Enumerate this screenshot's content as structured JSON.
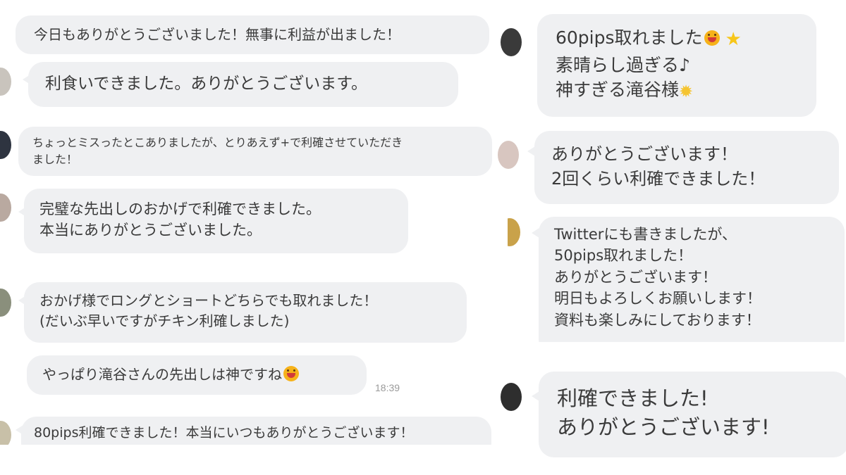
{
  "colors": {
    "bubble_bg": "#eff0f2",
    "text": "#3a3a3a",
    "time": "#9a9a9a"
  },
  "left_messages": [
    {
      "lines": [
        "今日もありがとうございました！無事に利益が出ました！"
      ]
    },
    {
      "lines": [
        "利食いできました。ありがとうございます。"
      ]
    },
    {
      "lines": [
        "ちょっとミスったとこありましたが、とりあえず+で利確させていただき",
        "ました！"
      ]
    },
    {
      "lines": [
        "完璧な先出しのおかげで利確できました。",
        "本当にありがとうございました。"
      ]
    },
    {
      "lines": [
        "おかげ様でロングとショートどちらでも取れました！",
        "(だいぶ早いですがチキン利確しました)"
      ]
    },
    {
      "lines": [
        "やっぱり滝谷さんの先出しは神ですね"
      ],
      "emoji": "grinning-face",
      "time": "18:39"
    },
    {
      "lines": [
        "80pips利確できました！本当にいつもありがとうございます！"
      ]
    }
  ],
  "right_messages": [
    {
      "lines": [
        "60pips取れました",
        "素晴らし過ぎる♪",
        "神すぎる滝谷様"
      ],
      "emoji": [
        "grinning-face",
        "star",
        "sun"
      ]
    },
    {
      "lines": [
        "ありがとうございます！",
        "2回くらい利確できました！"
      ]
    },
    {
      "lines": [
        "Twitterにも書きましたが、",
        "50pips取れました！",
        "ありがとうございます！",
        "明日もよろしくお願いします！",
        "資料も楽しみにしております！"
      ]
    },
    {
      "lines": [
        "利確できました!",
        "ありがとうございます!"
      ]
    }
  ]
}
